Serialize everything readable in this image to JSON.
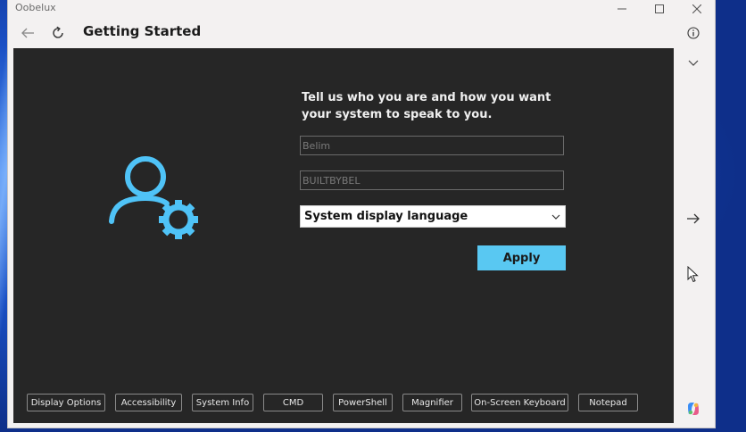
{
  "window": {
    "app_title": "Oobelux",
    "minimize_icon": "minimize-icon",
    "maximize_icon": "maximize-icon",
    "close_icon": "close-icon"
  },
  "nav": {
    "page_title": "Getting Started",
    "back_icon": "back-arrow-icon",
    "refresh_icon": "refresh-icon",
    "info_icon": "info-icon"
  },
  "form": {
    "prompt": "Tell us who you are and how you want your system to speak to you.",
    "name_value": "Belim",
    "computer_value": "BUILTBYBEL",
    "language_selected": "System display language",
    "apply_label": "Apply"
  },
  "right_rail": {
    "collapse_icon": "chevron-down-icon",
    "next_icon": "forward-arrow-icon",
    "cursor_icon": "mouse-pointer-icon"
  },
  "bottom_buttons": [
    "Display Options",
    "Accessibility",
    "System Info",
    "CMD",
    "PowerShell",
    "Magnifier",
    "On-Screen Keyboard",
    "Notepad"
  ],
  "colors": {
    "accent": "#59c8f2",
    "icon_blue": "#4fc3f7",
    "panel": "#262626"
  }
}
